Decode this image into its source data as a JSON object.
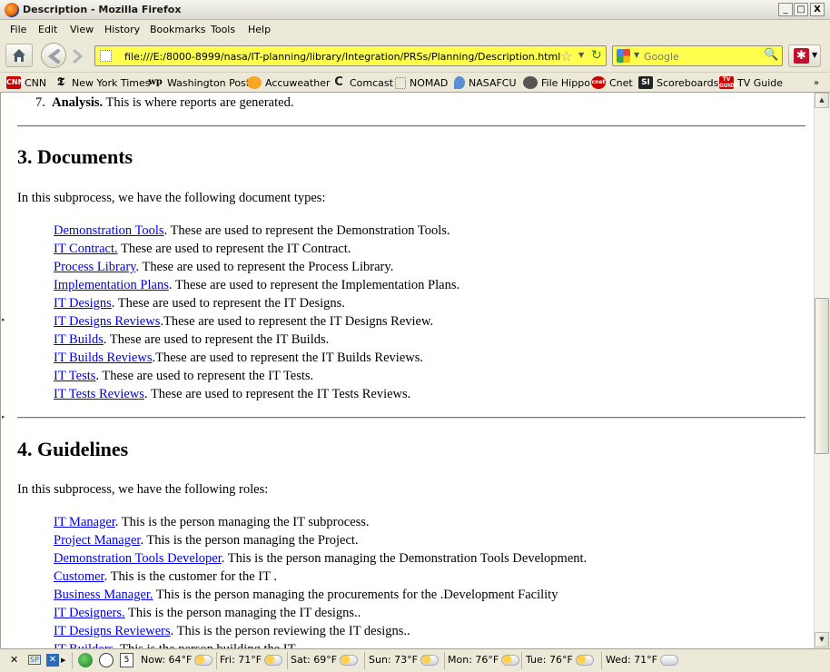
{
  "window": {
    "title": "Description - Mozilla Firefox",
    "minimize": "_",
    "maximize": "□",
    "close": "X"
  },
  "menu": [
    "File",
    "Edit",
    "View",
    "History",
    "Bookmarks",
    "Tools",
    "Help"
  ],
  "nav": {
    "url": "file:///E:/8000-8999/nasa/IT-planning/library/Integration/PRSs/Planning/Description.html",
    "search_placeholder": "Google"
  },
  "bookmarks": [
    {
      "label": "CNN",
      "icon": "cnn-icon",
      "color": "#cc0000"
    },
    {
      "label": "New York Times",
      "icon": "nyt-icon",
      "color": "#000000"
    },
    {
      "label": "Washington Post",
      "icon": "wp-icon",
      "color": "#000000"
    },
    {
      "label": "Accuweather",
      "icon": "accuweather-icon",
      "color": "#f39c12"
    },
    {
      "label": "Comcast",
      "icon": "comcast-icon",
      "color": "#333333"
    },
    {
      "label": "NOMAD",
      "icon": "blank-page-icon",
      "color": "#ffffff"
    },
    {
      "label": "NASAFCU",
      "icon": "nasafcu-icon",
      "color": "#3a7bd5"
    },
    {
      "label": "File Hippo",
      "icon": "filehippo-icon",
      "color": "#444444"
    },
    {
      "label": "Cnet",
      "icon": "cnet-icon",
      "color": "#cc0000"
    },
    {
      "label": "Scoreboards",
      "icon": "si-icon",
      "color": "#222222"
    },
    {
      "label": "TV Guide",
      "icon": "tvguide-icon",
      "color": "#cc0000"
    }
  ],
  "page": {
    "top_item": {
      "number": "7.",
      "bold": "Analysis.",
      "text": " This is where reports are generated."
    },
    "section3": {
      "heading": "3. Documents",
      "intro": "In this subprocess, we have the following document types:",
      "items": [
        {
          "link": "Demonstration Tools",
          "text": ". These are used to represent the Demonstration Tools."
        },
        {
          "link": "IT Contract.",
          "text": " These are used to represent the IT Contract."
        },
        {
          "link": "Process Library",
          "text": ". These are used to represent the Process Library."
        },
        {
          "link": "Implementation Plans",
          "text": ". These are used to represent the Implementation Plans."
        },
        {
          "link": "IT Designs",
          "text": ". These are used to represent the IT Designs."
        },
        {
          "link": "IT Designs Reviews",
          "text": ".These are used to represent the IT Designs Review."
        },
        {
          "link": "IT Builds",
          "text": ". These are used to represent the IT Builds."
        },
        {
          "link": "IT Builds Reviews",
          "text": ".These are used to represent the IT Builds Reviews."
        },
        {
          "link": "IT Tests",
          "text": ". These are used to represent the IT Tests."
        },
        {
          "link": "IT Tests Reviews",
          "text": ". These are used to represent the IT Tests Reviews."
        }
      ]
    },
    "section4": {
      "heading": "4. Guidelines",
      "intro": "In this subprocess, we have the following roles:",
      "items": [
        {
          "link": "IT Manager",
          "text": ". This is the person managing the IT subprocess."
        },
        {
          "link": "Project Manager",
          "text": ". This is the person managing the Project."
        },
        {
          "link": "Demonstration Tools Developer",
          "text": ". This is the person managing the Demonstration Tools Development."
        },
        {
          "link": "Customer",
          "text": ". This is the customer for the IT ."
        },
        {
          "link": "Business Manager.",
          "text": " This is the person managing the procurements for the .Development Facility"
        },
        {
          "link": "IT Designers.",
          "text": " This is the person managing the IT designs.."
        },
        {
          "link": "IT Designs Reviewers",
          "text": ". This is the person reviewing the IT designs.."
        },
        {
          "link": "IT Builders",
          "text": ". This is the person building the IT."
        }
      ]
    }
  },
  "status": {
    "close": "✕",
    "sp": "SP",
    "calendar_day": "5",
    "weather": [
      {
        "label": "Now: 64°F"
      },
      {
        "label": "Fri: 71°F"
      },
      {
        "label": "Sat: 69°F"
      },
      {
        "label": "Sun: 73°F"
      },
      {
        "label": "Mon: 76°F"
      },
      {
        "label": "Tue: 76°F"
      },
      {
        "label": "Wed: 71°F"
      }
    ]
  }
}
